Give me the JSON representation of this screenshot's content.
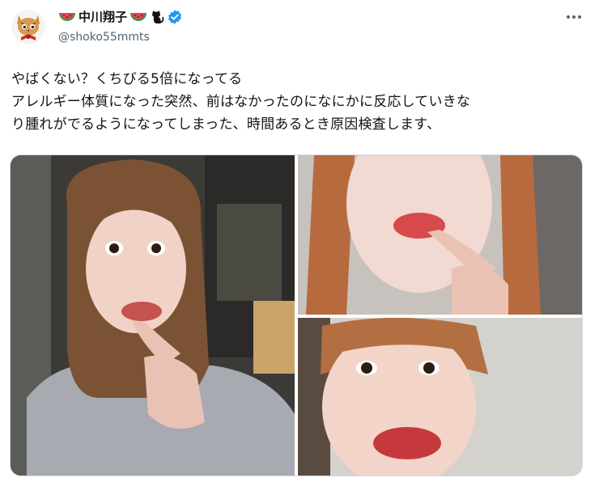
{
  "user": {
    "display_name": "中川翔子",
    "handle": "@shoko55mmts",
    "name_emojis": [
      "watermelon-icon",
      "watermelon-icon",
      "black-cat-icon"
    ],
    "verified_color": "#1d9bf0"
  },
  "tweet": {
    "lines": [
      "やばくない？くちびる5倍になってる",
      "アレルギー体質になった突然、前はなかったのになにかに反応していきな",
      "り腫れがでるようになってしまった、時間あるとき原因検査します、"
    ]
  },
  "media": {
    "photos": [
      "selfie-photo-left",
      "selfie-photo-top-right",
      "selfie-photo-bottom-right"
    ]
  }
}
